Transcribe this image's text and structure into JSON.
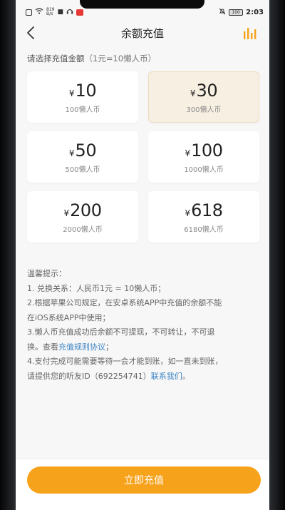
{
  "statusbar": {
    "net_speed": "819",
    "net_unit": "B/s",
    "battery": "100",
    "time": "2:03"
  },
  "header": {
    "title": "余额充值"
  },
  "prompt": {
    "text": "请选择充值金额",
    "rate": "（1元=10懒人币）"
  },
  "currency_symbol": "¥",
  "options": [
    {
      "amount": "10",
      "coins": "100懒人币",
      "selected": false
    },
    {
      "amount": "30",
      "coins": "300懒人币",
      "selected": true
    },
    {
      "amount": "50",
      "coins": "500懒人币",
      "selected": false
    },
    {
      "amount": "100",
      "coins": "1000懒人币",
      "selected": false
    },
    {
      "amount": "200",
      "coins": "2000懒人币",
      "selected": false
    },
    {
      "amount": "618",
      "coins": "6180懒人币",
      "selected": false
    }
  ],
  "tips": {
    "heading": "温馨提示：",
    "line1": "1. 兑换关系：人民币1元 = 10懒人币；",
    "line2a": "2.根据苹果公司规定，在安卓系统APP中充值的余额不能",
    "line2b": "在iOS系统APP中使用；",
    "line3a": "3.懒人币充值成功后余额不可提现，不可转让，不可退",
    "line3b_prefix": "换。查看",
    "line3b_link": "充值规则协议",
    "line3b_suffix": "；",
    "line4a": "4.支付完成可能需要等待一会才能到账，如一直未到账，",
    "line4b_prefix": "请提供您的听友ID（692254741）",
    "line4b_link": "联系我们",
    "line4b_suffix": "。"
  },
  "submit_label": "立即充值",
  "colors": {
    "accent": "#f7a21b",
    "link": "#3b82c4",
    "selected_card": "#f7efe2"
  }
}
